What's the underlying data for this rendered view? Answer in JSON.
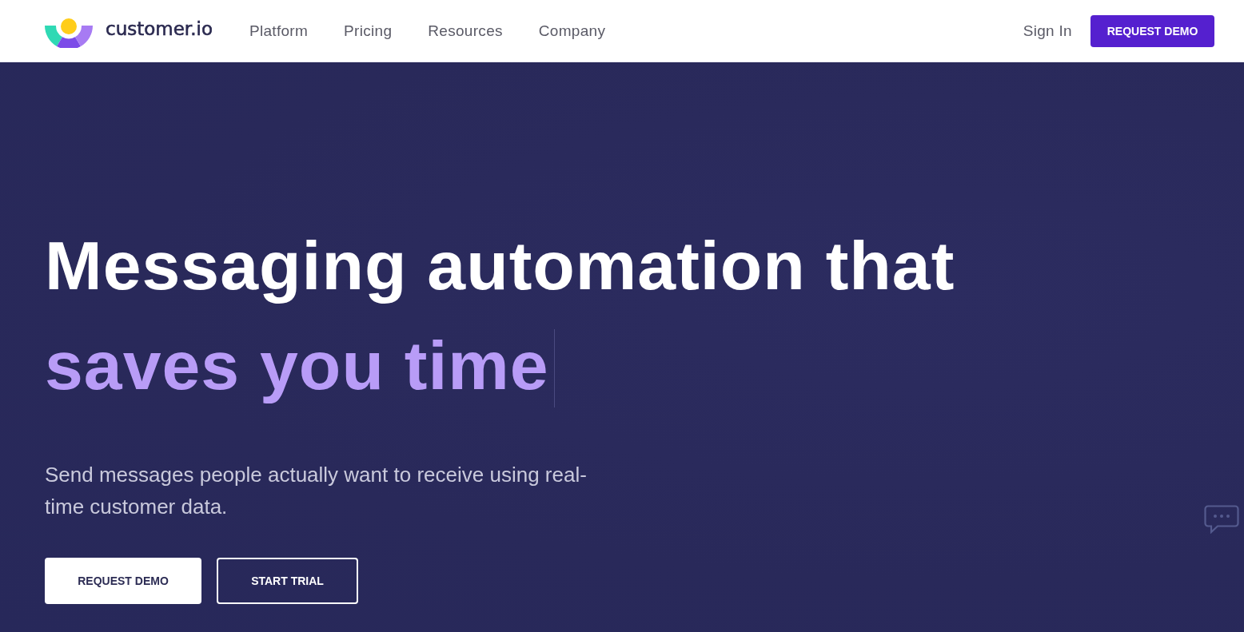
{
  "header": {
    "logo": {
      "wordmark": "customer.io"
    },
    "nav": [
      {
        "label": "Platform"
      },
      {
        "label": "Pricing"
      },
      {
        "label": "Resources"
      },
      {
        "label": "Company"
      }
    ],
    "sign_in": "Sign In",
    "cta": "REQUEST DEMO"
  },
  "hero": {
    "headline": "Messaging automation that",
    "headline_highlight": "saves you time",
    "subtitle": "Send messages people actually want to receive using real-time customer data.",
    "buttons": [
      {
        "label": "REQUEST DEMO",
        "kind": "solid"
      },
      {
        "label": "START TRIAL",
        "kind": "outline"
      }
    ]
  }
}
